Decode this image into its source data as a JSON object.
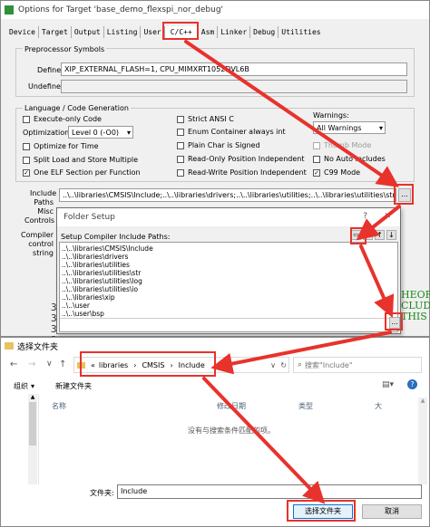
{
  "target_dialog": {
    "title": "Options for Target 'base_demo_flexspi_nor_debug'",
    "tabs": [
      "Device",
      "Target",
      "Output",
      "Listing",
      "User",
      "C/C++",
      "Asm",
      "Linker",
      "Debug",
      "Utilities"
    ],
    "active_tab": "C/C++",
    "preprocessor": {
      "group_label": "Preprocessor Symbols",
      "define_label": "Define:",
      "define_value": "XIP_EXTERNAL_FLASH=1, CPU_MIMXRT1052DVL6B",
      "undefine_label": "Undefine:"
    },
    "language": {
      "group_label": "Language / Code Generation",
      "execute_only": "Execute-only Code",
      "optimization_label": "Optimization:",
      "optimization_value": "Level 0 (-O0)",
      "optimize_time": "Optimize for Time",
      "split_load": "Split Load and Store Multiple",
      "one_elf": "One ELF Section per Function",
      "strict_ansi": "Strict ANSI C",
      "enum_int": "Enum Container always int",
      "plain_char": "Plain Char is Signed",
      "ro_pi": "Read-Only Position Independent",
      "rw_pi": "Read-Write Position Independent",
      "warnings_label": "Warnings:",
      "warnings_value": "All Warnings",
      "thumb_mode": "Thumb Mode",
      "no_auto_includes": "No Auto Includes",
      "c99_mode": "C99 Mode"
    },
    "include_label_1": "Include",
    "include_label_2": "Paths",
    "include_value": "..\\..\\libraries\\CMSIS\\Include;..\\..\\libraries\\drivers;..\\..\\libraries\\utilities;..\\..\\libraries\\utilities\\str;..\\..\\libraries\\utilities",
    "misc_label_1": "Misc",
    "misc_label_2": "Controls",
    "compiler_label_1": "Compiler",
    "compiler_label_2": "control",
    "compiler_label_3": "string",
    "browse": "..."
  },
  "folder_dialog": {
    "title": "Folder Setup",
    "help": "?",
    "close": "✕",
    "list_label": "Setup Compiler Include Paths:",
    "paths": [
      "..\\..\\libraries\\CMSIS\\Include",
      "..\\..\\libraries\\drivers",
      "..\\..\\libraries\\utilities",
      "..\\..\\libraries\\utilities\\str",
      "..\\..\\libraries\\utilities\\log",
      "..\\..\\libraries\\utilities\\io",
      "..\\..\\libraries\\xip",
      "..\\..\\user",
      "..\\..\\user\\bsp"
    ],
    "browse": "..."
  },
  "background_code": {
    "digits": [
      "3",
      "3",
      "3",
      "3"
    ],
    "right_text": [
      "HEORY",
      "CLUDI",
      "THIS"
    ]
  },
  "file_dialog": {
    "title": "选择文件夹",
    "breadcrumb": [
      "«",
      "libraries",
      "CMSIS",
      "Include"
    ],
    "search_placeholder": "搜索\"Include\"",
    "organize": "组织",
    "new_folder": "新建文件夹",
    "col_name": "名称",
    "col_date": "修改日期",
    "col_type": "类型",
    "col_size": "大",
    "empty_msg": "没有与搜索条件匹配的项。",
    "folder_label": "文件夹:",
    "folder_value": "Include",
    "select_button": "选择文件夹",
    "cancel_button": "取消"
  }
}
